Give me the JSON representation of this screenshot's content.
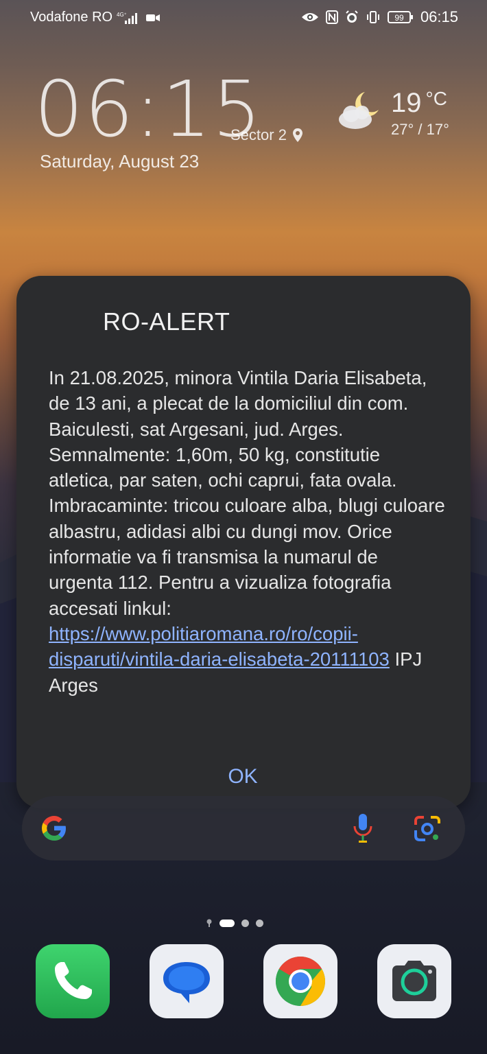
{
  "status_bar": {
    "carrier": "Vodafone RO",
    "network_badge": "4G+",
    "battery": "99",
    "time": "06:15",
    "icons": [
      "signal-icon",
      "video-call-icon",
      "eye-icon",
      "nfc-icon",
      "alarm-icon",
      "vibrate-icon",
      "battery-icon"
    ]
  },
  "clock_widget": {
    "time": "06:15",
    "location": "Sector 2",
    "date": "Saturday, August 23"
  },
  "weather": {
    "temp": "19",
    "unit": "°C",
    "range": "27° / 17°",
    "icon": "partly-cloudy-night-icon"
  },
  "alert": {
    "title": "RO-ALERT",
    "body_text": "In 21.08.2025, minora Vintila Daria Elisabeta, de 13 ani, a plecat de la domiciliul din com. Baiculesti, sat Argesani, jud. Arges. Semnalmente: 1,60m, 50 kg, constitutie atletica, par saten, ochi caprui, fata ovala. Imbracaminte: tricou culoare alba, blugi culoare albastru, adidasi albi cu dungi mov. Orice informatie va fi transmisa la numarul de urgenta 112. Pentru a vizualiza fotografia accesati linkul:",
    "link": "https://www.politiaromana.ro/ro/copii-disparuti/vintila-daria-elisabeta-20111103",
    "suffix": "IPJ Arges",
    "ok_label": "OK"
  },
  "search_bar": {
    "icons": [
      "google-logo-icon",
      "microphone-icon",
      "google-lens-icon"
    ]
  },
  "dock": {
    "apps": [
      "phone",
      "messages",
      "chrome",
      "camera"
    ]
  },
  "colors": {
    "dialog_bg": "#2b2c2e",
    "link": "#8fb4ff",
    "ok": "#8fb4ff"
  }
}
